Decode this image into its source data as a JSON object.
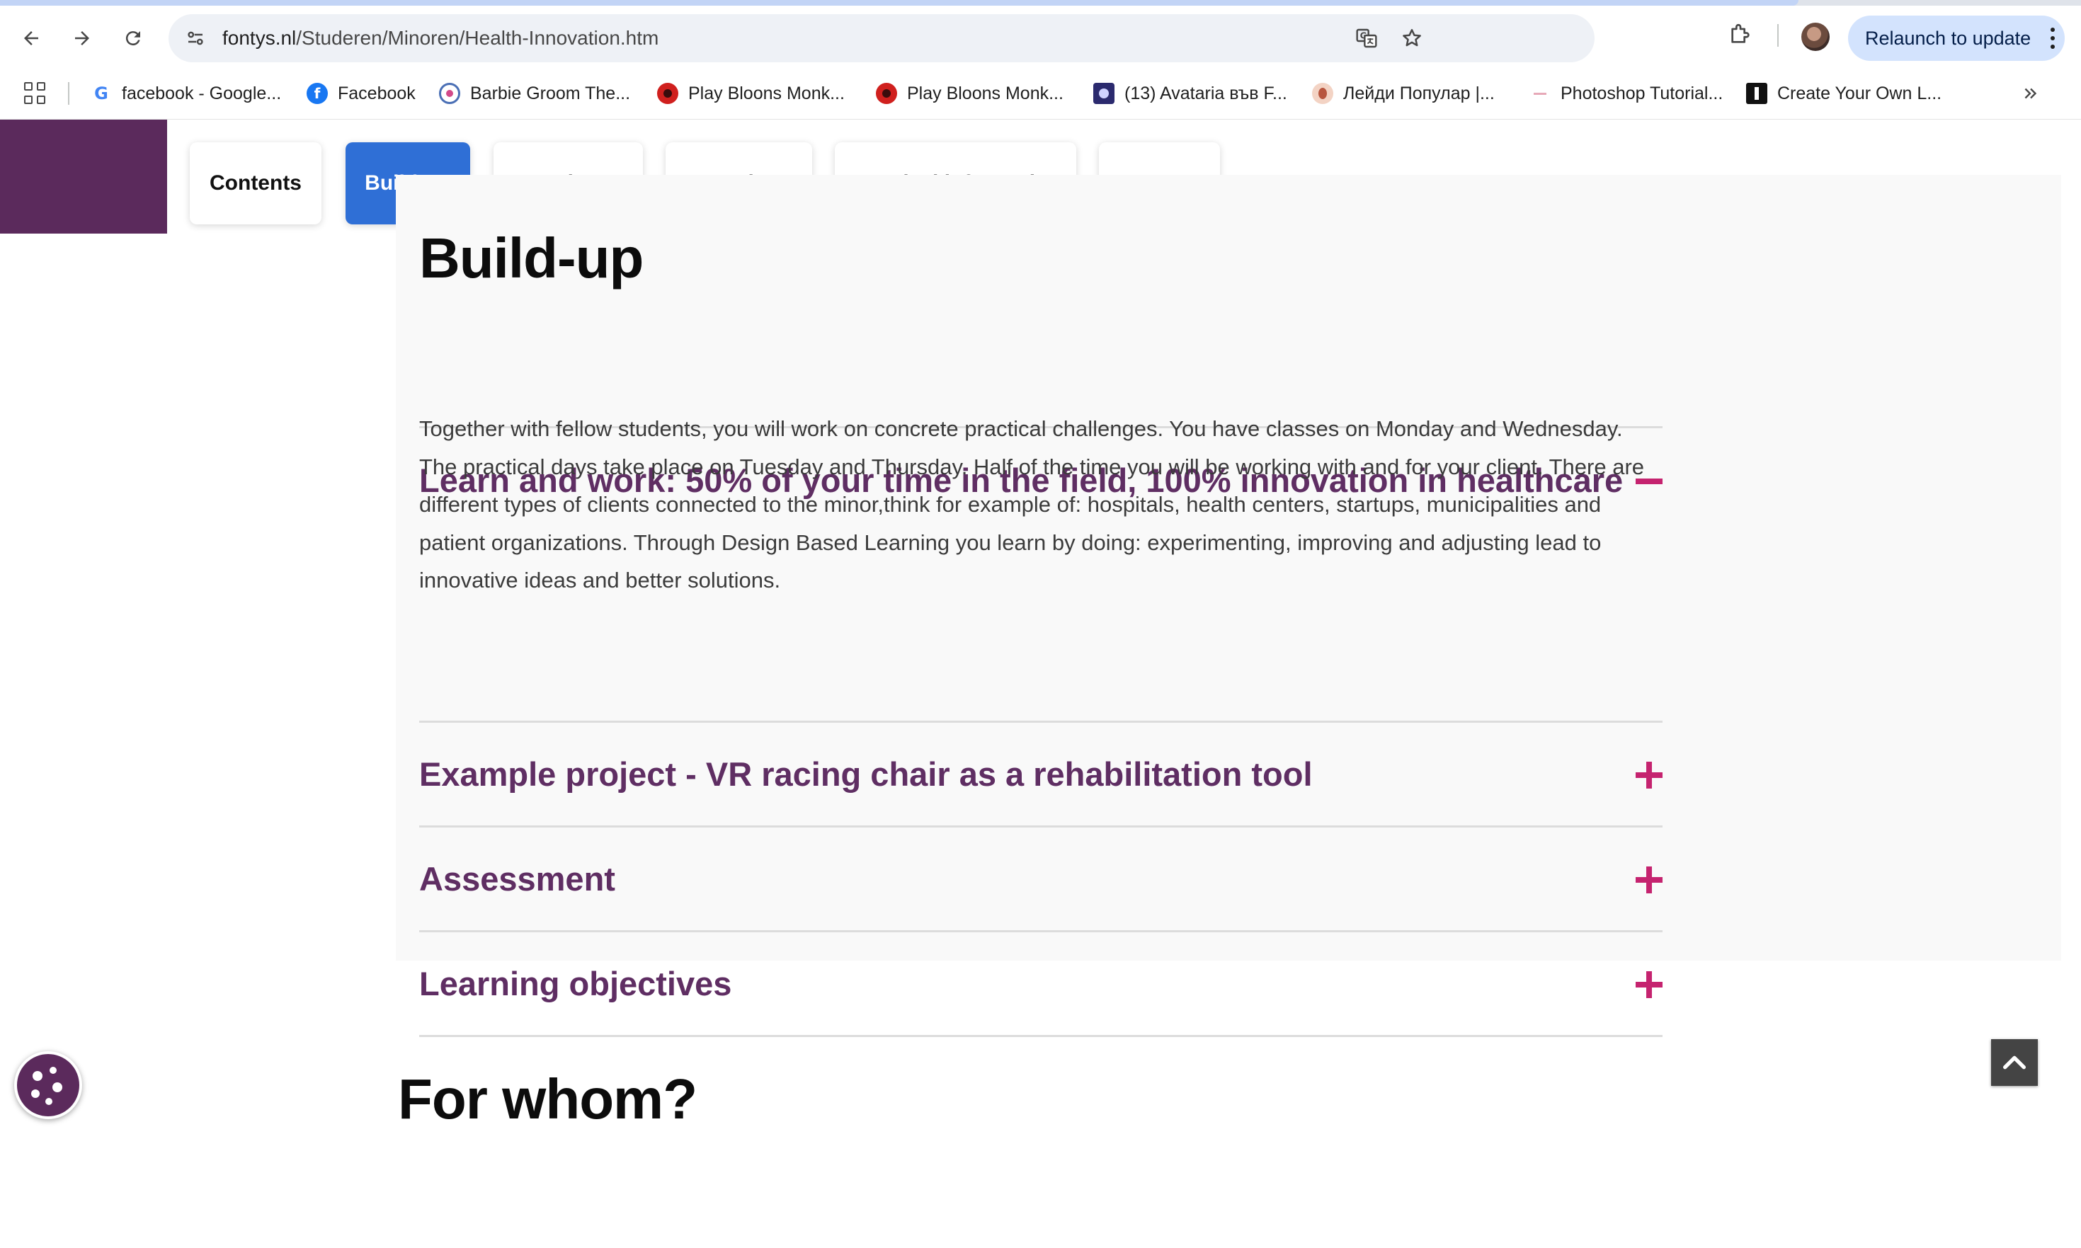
{
  "browser": {
    "url_host": "fontys.nl",
    "url_path": "/Studeren/Minoren/Health-Innovation.htm",
    "relaunch_label": "Relaunch to update",
    "bookmarks": [
      {
        "label": "facebook - Google...",
        "icon": "google-g-icon"
      },
      {
        "label": "Facebook",
        "icon": "facebook-icon"
      },
      {
        "label": "Barbie Groom The...",
        "icon": "barbie-site-icon"
      },
      {
        "label": "Play Bloons Monk...",
        "icon": "bloons-icon"
      },
      {
        "label": "Play Bloons Monk...",
        "icon": "bloons-icon"
      },
      {
        "label": "(13) Avataria във F...",
        "icon": "avataria-icon"
      },
      {
        "label": "Лейди Популар |...",
        "icon": "lady-popular-icon"
      },
      {
        "label": "Photoshop Tutorial...",
        "icon": "photoshop-tutorial-icon"
      },
      {
        "label": "Create Your Own L...",
        "icon": "create-logo-icon"
      }
    ]
  },
  "subnav": {
    "items": [
      "Contents",
      "Build-up",
      "For whom?",
      "To register",
      "Practical information",
      "Contact"
    ],
    "active": "Build-up"
  },
  "buildup": {
    "title": "Build-up",
    "accordion": [
      {
        "title": "Learn and work: 50% of your time in the field, 100% innovation in healthcare",
        "expanded": true,
        "body": "Together with fellow students, you will work on concrete practical challenges. You have classes on Monday and Wednesday. The practical days take place on Tuesday and Thursday. Half of the time you will be working with and for your client. There are different types of clients connected to the minor,think for example of: hospitals, health centers, startups, municipalities and patient organizations. Through Design Based Learning you learn by doing: experimenting, improving and adjusting lead to innovative ideas and better solutions."
      },
      {
        "title": "Example project - VR racing chair as a rehabilitation tool",
        "expanded": false
      },
      {
        "title": "Assessment",
        "expanded": false
      },
      {
        "title": "Learning objectives",
        "expanded": false
      }
    ]
  },
  "next_section": {
    "title": "For whom?"
  },
  "colors": {
    "brand_purple": "#5b2a5c",
    "accordion_title": "#5f2e63",
    "accordion_icon": "#c5236f",
    "active_tab": "#2f6fd6"
  }
}
